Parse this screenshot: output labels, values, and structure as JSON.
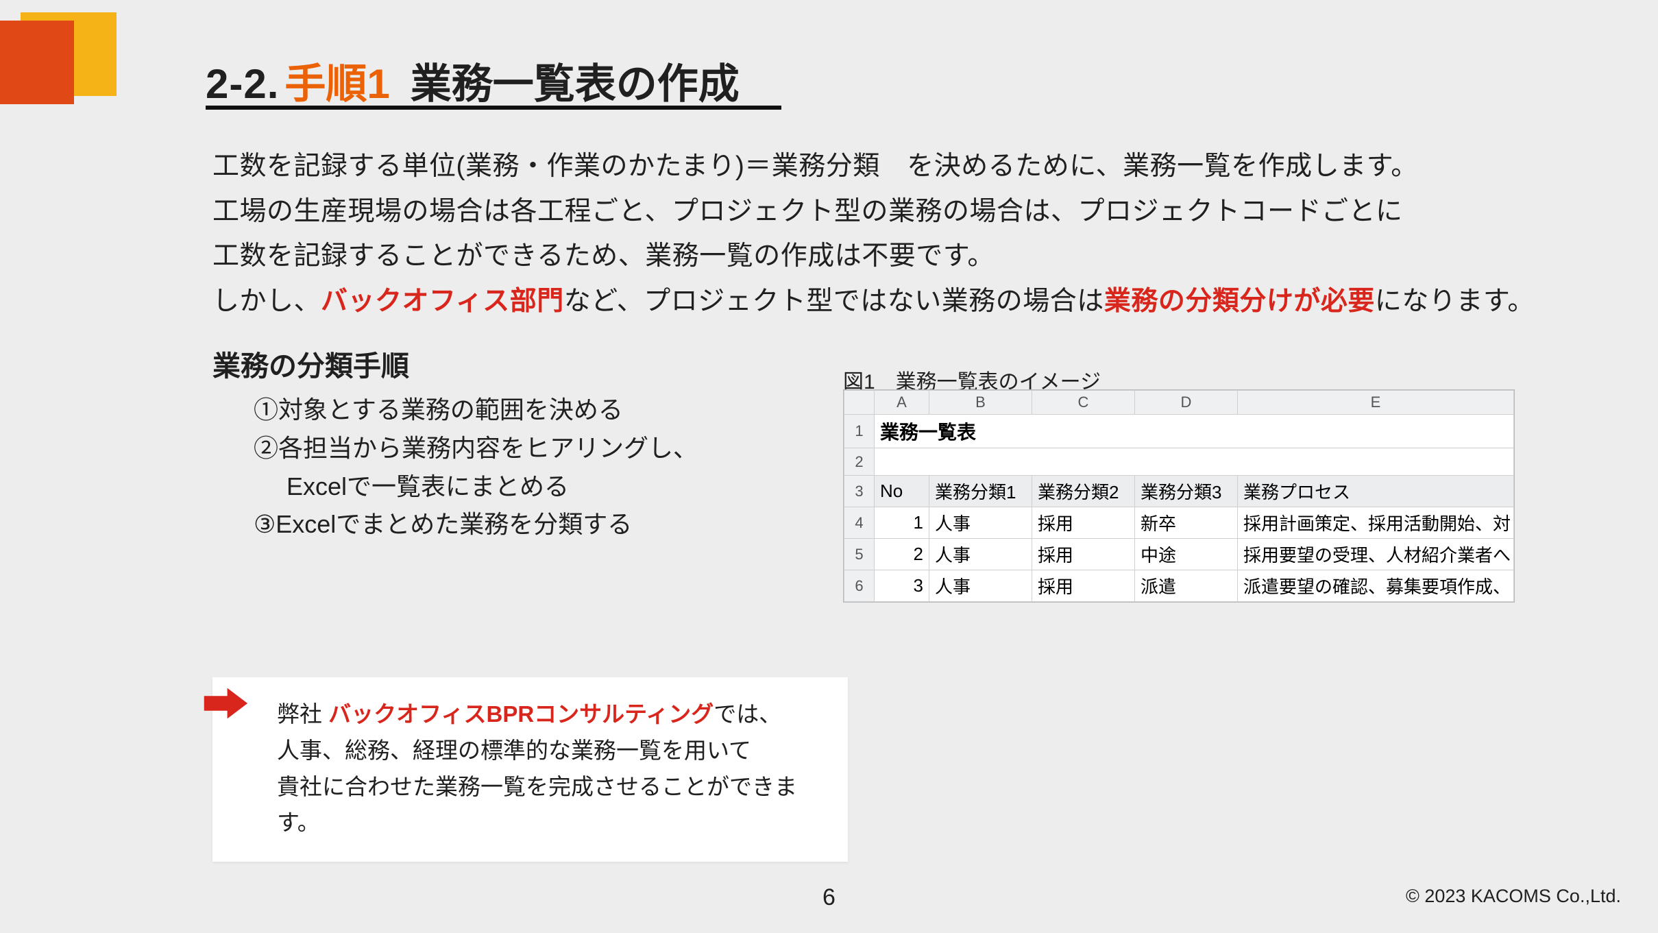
{
  "title": {
    "prefix": "2-2.",
    "step": "手順1",
    "main": "業務一覧表の作成"
  },
  "body": {
    "p1": "工数を記録する単位(業務・作業のかたまり)＝業務分類　を決めるために、業務一覧を作成します。",
    "p2": "工場の生産現場の場合は各工程ごと、プロジェクト型の業務の場合は、プロジェクトコードごとに",
    "p3": "工数を記録することができるため、業務一覧の作成は不要です。",
    "p4a": "しかし、",
    "p4hl1": "バックオフィス部門",
    "p4b": "など、プロジェクト型ではない業務の場合は",
    "p4hl2": "業務の分類分けが必要",
    "p4c": "になります。"
  },
  "subheading": "業務の分類手順",
  "steps": {
    "s1": "①対象とする業務の範囲を決める",
    "s2": "②各担当から業務内容をヒアリングし、",
    "s2b": "Excelで一覧表にまとめる",
    "s3": "③Excelでまとめた業務を分類する"
  },
  "figure": {
    "caption": "図1　業務一覧表のイメージ"
  },
  "excel": {
    "cols": [
      "A",
      "B",
      "C",
      "D",
      "E"
    ],
    "row1": {
      "titlecell": "業務一覧表"
    },
    "header": [
      "No",
      "業務分類1",
      "業務分類2",
      "業務分類3",
      "業務プロセス"
    ],
    "rows": [
      {
        "no": "1",
        "c1": "人事",
        "c2": "採用",
        "c3": "新卒",
        "proc": "採用計画策定、採用活動開始、対"
      },
      {
        "no": "2",
        "c1": "人事",
        "c2": "採用",
        "c3": "中途",
        "proc": "採用要望の受理、人材紹介業者へ"
      },
      {
        "no": "3",
        "c1": "人事",
        "c2": "採用",
        "c3": "派遣",
        "proc": "派遣要望の確認、募集要項作成、"
      }
    ],
    "rownums": [
      "1",
      "2",
      "3",
      "4",
      "5",
      "6"
    ]
  },
  "callout": {
    "t1": "弊社 ",
    "hl": "バックオフィスBPRコンサルティング",
    "t1b": "では、",
    "t2": "人事、総務、経理の標準的な業務一覧を用いて",
    "t3": "貴社に合わせた業務一覧を完成させることができます。"
  },
  "page_number": "6",
  "copyright": "© 2023 KACOMS Co.,Ltd."
}
